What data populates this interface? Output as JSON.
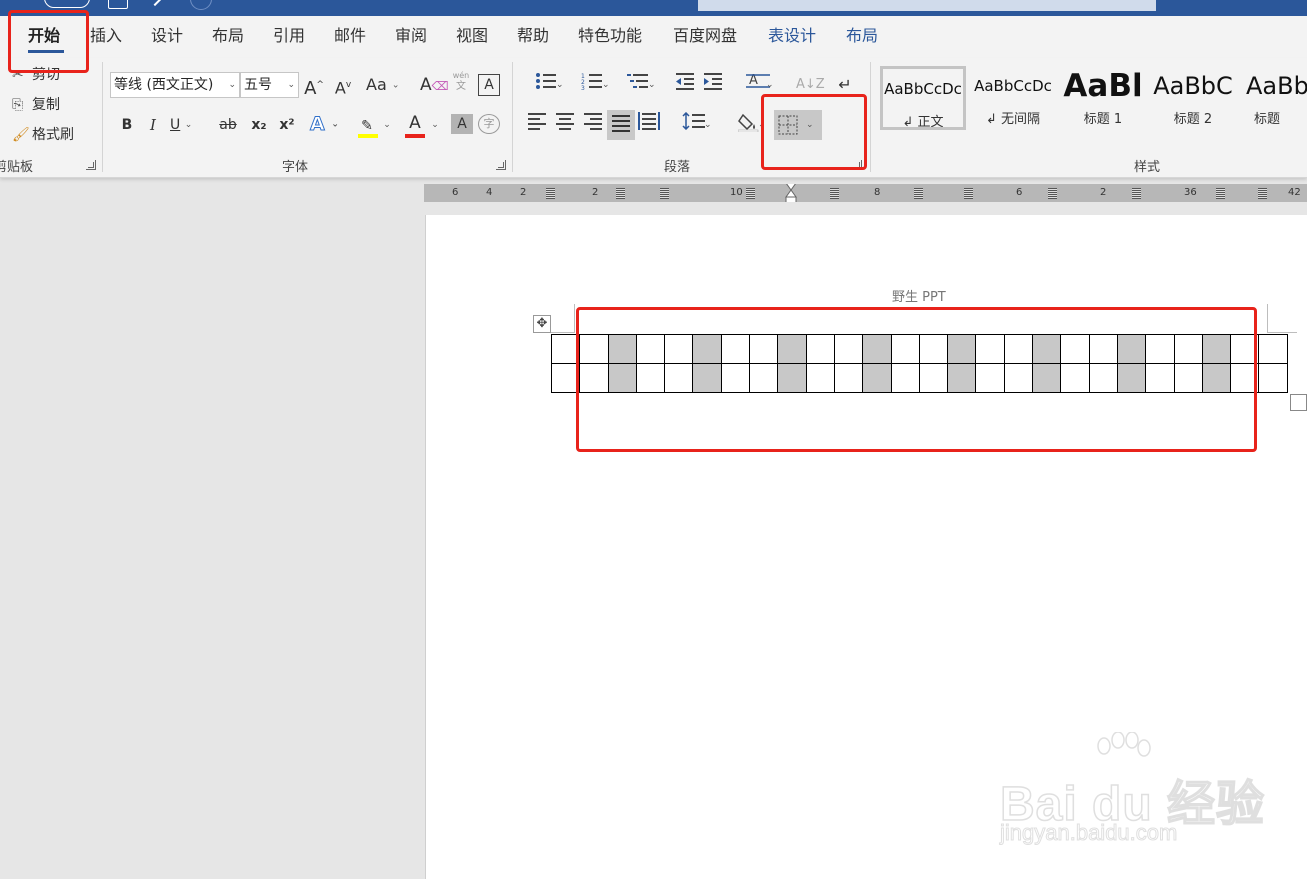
{
  "tabs": {
    "items": [
      {
        "label": "开始",
        "active": true
      },
      {
        "label": "插入"
      },
      {
        "label": "设计"
      },
      {
        "label": "布局"
      },
      {
        "label": "引用"
      },
      {
        "label": "邮件"
      },
      {
        "label": "审阅"
      },
      {
        "label": "视图"
      },
      {
        "label": "帮助"
      },
      {
        "label": "特色功能"
      },
      {
        "label": "百度网盘"
      },
      {
        "label": "表设计",
        "contextual": true
      },
      {
        "label": "布局",
        "contextual": true
      }
    ]
  },
  "ribbon": {
    "clipboard": {
      "cut_label": "剪切",
      "copy_label": "复制",
      "format_painter_label": "格式刷",
      "group_label": "剪贴板"
    },
    "font": {
      "font_name": "等线 (西文正文)",
      "font_size": "五号",
      "change_case_label": "Aa",
      "phonetic_top": "wén",
      "phonetic_bottom": "文",
      "char_border_label": "A",
      "bold_label": "B",
      "italic_label": "I",
      "underline_label": "U",
      "strike_label": "ab",
      "subscript_label": "x₂",
      "superscript_label": "x²",
      "text_effect_label": "A",
      "font_color_label": "A",
      "char_shading_label": "A",
      "enclose_label": "字",
      "grow_label": "A",
      "shrink_label": "A",
      "group_label": "字体",
      "highlight_color": "#ffff00",
      "font_color": "#e8231b"
    },
    "paragraph": {
      "group_label": "段落"
    },
    "styles": {
      "group_label": "样式",
      "items": [
        {
          "sample": "AaBbCcDc",
          "name": "正文",
          "selected": true
        },
        {
          "sample": "AaBbCcDc",
          "name": "无间隔"
        },
        {
          "sample": "AaBl",
          "name": "标题 1"
        },
        {
          "sample": "AaBbC",
          "name": "标题 2"
        },
        {
          "sample": "AaBb",
          "name": "标题"
        }
      ]
    }
  },
  "ruler": {
    "labels": [
      "6",
      "4",
      "2",
      "2",
      "10",
      "8",
      "6",
      "2",
      "36",
      "42"
    ]
  },
  "document": {
    "header_text": "野生 PPT",
    "table": {
      "rows": 2,
      "cols": 26,
      "shaded_cols": [
        2,
        5,
        8,
        11,
        14,
        17,
        20,
        23
      ]
    }
  },
  "watermark": {
    "brand": "Bai du 经验",
    "url": "jingyan.baidu.com"
  },
  "colors": {
    "accent": "#2b579a",
    "highlight_box": "#e8231b",
    "cell_shading": "#c8c8c8"
  }
}
